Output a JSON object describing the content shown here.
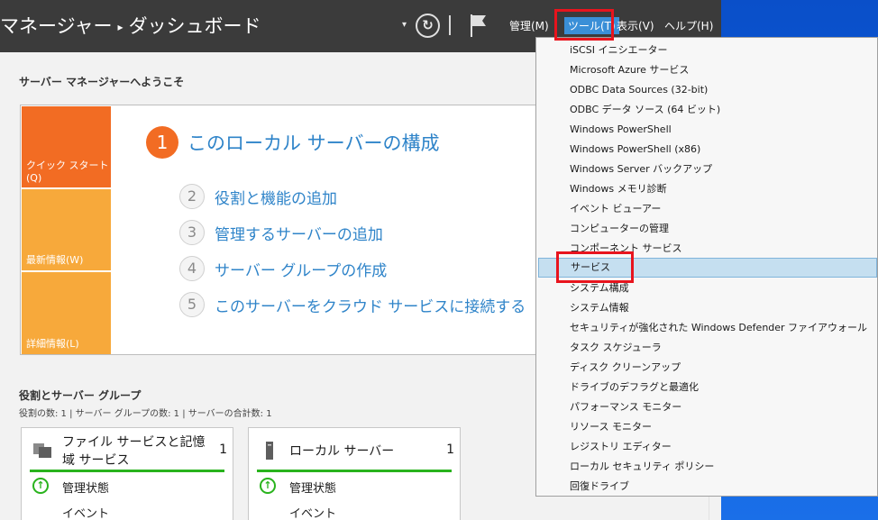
{
  "titlebar": {
    "title_part1": "マネージャー",
    "title_sep": "▸",
    "title_part2": "ダッシュボード",
    "menu": {
      "manage": "管理(M)",
      "tools": "ツール(T)",
      "view": "表示(V)",
      "help": "ヘルプ(H)"
    },
    "icons": [
      "dropdown-caret",
      "refresh-icon",
      "flag-icon"
    ]
  },
  "welcome": {
    "title": "サーバー マネージャーへようこそ",
    "tiles": {
      "quick_start": "クイック スタート(Q)",
      "news": "最新情報(W)",
      "details": "詳細情報(L)"
    },
    "steps": [
      {
        "num": "1",
        "label": "このローカル サーバーの構成"
      },
      {
        "num": "2",
        "label": "役割と機能の追加"
      },
      {
        "num": "3",
        "label": "管理するサーバーの追加"
      },
      {
        "num": "4",
        "label": "サーバー グループの作成"
      },
      {
        "num": "5",
        "label": "このサーバーをクラウド サービスに接続する"
      }
    ]
  },
  "roles": {
    "title": "役割とサーバー グループ",
    "counts": "役割の数: 1 | サーバー グループの数: 1 | サーバーの合計数: 1",
    "cards": [
      {
        "title": "ファイル サービスと記憶域 サービス",
        "count": "1",
        "status": "管理状態",
        "events": "イベント"
      },
      {
        "title": "ローカル サーバー",
        "count": "1",
        "status": "管理状態",
        "events": "イベント"
      }
    ]
  },
  "tools_menu": {
    "items": [
      "iSCSI イニシエーター",
      "Microsoft Azure サービス",
      "ODBC Data Sources (32-bit)",
      "ODBC データ ソース (64 ビット)",
      "Windows PowerShell",
      "Windows PowerShell (x86)",
      "Windows Server バックアップ",
      "Windows メモリ診断",
      "イベント ビューアー",
      "コンピューターの管理",
      "コンポーネント サービス",
      "サービス",
      "システム構成",
      "システム情報",
      "セキュリティが強化された Windows Defender ファイアウォール",
      "タスク スケジューラ",
      "ディスク クリーンアップ",
      "ドライブのデフラグと最適化",
      "パフォーマンス モニター",
      "リソース モニター",
      "レジストリ エディター",
      "ローカル セキュリティ ポリシー",
      "回復ドライブ"
    ],
    "selected": "サービス"
  },
  "colors": {
    "titlebar_bg": "#3b3b3b",
    "accent_orange": "#f26c23",
    "tile_orange_light": "#f7a93b",
    "link_blue": "#2f84c9",
    "status_green": "#29b31d",
    "highlight_red": "#e8141d",
    "menu_selected_bg": "#c5dff0"
  }
}
